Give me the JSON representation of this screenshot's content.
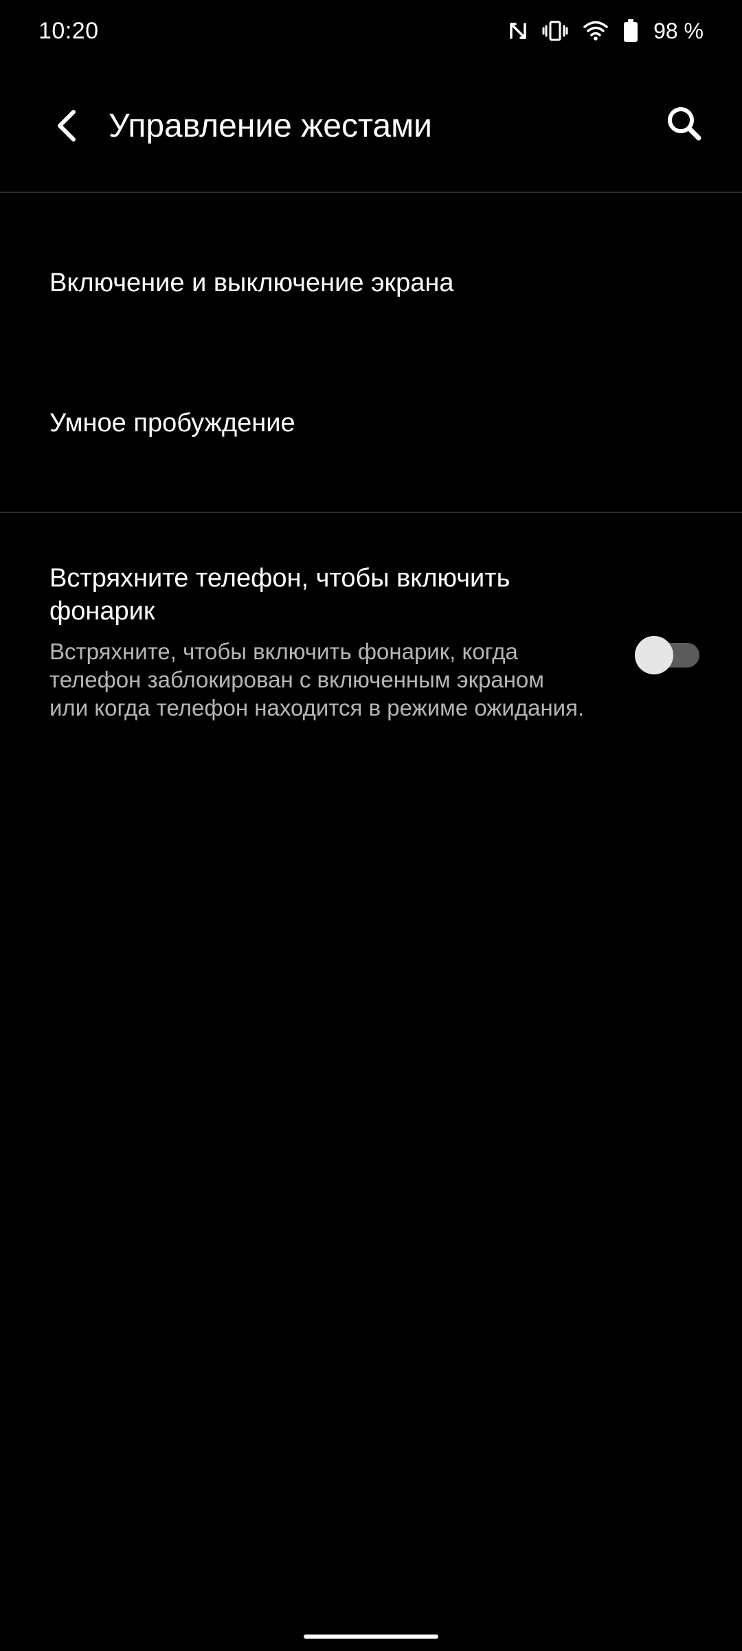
{
  "status_bar": {
    "time": "10:20",
    "battery": "98 %",
    "icons": [
      "nfc-icon",
      "vibrate-icon",
      "wifi-icon",
      "battery-icon"
    ]
  },
  "app_bar": {
    "title": "Управление жестами",
    "back_icon": "chevron-left-icon",
    "search_icon": "search-icon"
  },
  "items": [
    {
      "title": "Включение и выключение экрана"
    },
    {
      "title": "Умное пробуждение"
    }
  ],
  "shake_flashlight": {
    "title": "Встряхните телефон, чтобы включить фонарик",
    "description": "Встряхните, чтобы включить фонарик, когда телефон заблокирован с включенным экраном или когда телефон находится в режиме ожидания.",
    "enabled": false
  },
  "colors": {
    "background": "#000000",
    "text_primary": "#ffffff",
    "text_secondary": "#b6b6b6",
    "divider": "#2a2a2a",
    "switch_track_off": "#5b5b5b",
    "switch_thumb_off": "#e6e6e6"
  }
}
